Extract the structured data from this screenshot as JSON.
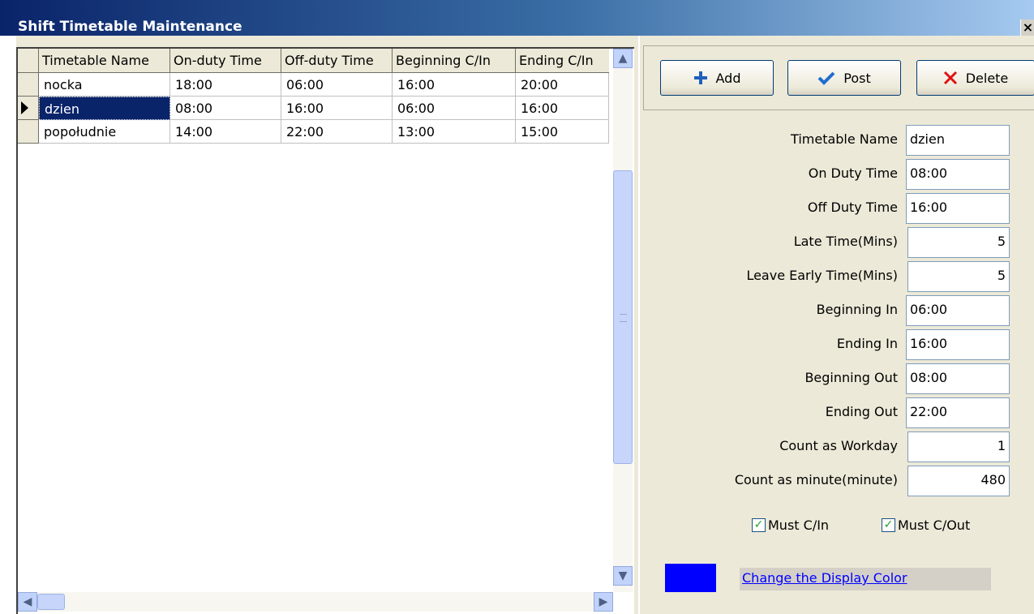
{
  "window": {
    "title": "Shift Timetable Maintenance",
    "close_glyph": "×"
  },
  "grid": {
    "columns": [
      "Timetable Name",
      "On-duty Time",
      "Off-duty Time",
      "Beginning C/In",
      "Ending C/In"
    ],
    "rows": [
      {
        "name": "nocka",
        "on": "18:00",
        "off": "06:00",
        "begin": "16:00",
        "end": "20:00",
        "selected": false
      },
      {
        "name": "dzien",
        "on": "08:00",
        "off": "16:00",
        "begin": "06:00",
        "end": "16:00",
        "selected": true
      },
      {
        "name": "popołudnie",
        "on": "14:00",
        "off": "22:00",
        "begin": "13:00",
        "end": "15:00",
        "selected": false
      }
    ]
  },
  "toolbar": {
    "add_label": "Add",
    "post_label": "Post",
    "delete_label": "Delete"
  },
  "form": {
    "timetable_name": {
      "label": "Timetable Name",
      "value": "dzien"
    },
    "on_duty": {
      "label": "On Duty Time",
      "value": "08:00"
    },
    "off_duty": {
      "label": "Off Duty Time",
      "value": "16:00"
    },
    "late_time": {
      "label": "Late Time(Mins)",
      "value": "5"
    },
    "leave_early": {
      "label": "Leave Early Time(Mins)",
      "value": "5"
    },
    "beginning_in": {
      "label": "Beginning In",
      "value": "06:00"
    },
    "ending_in": {
      "label": "Ending In",
      "value": "16:00"
    },
    "beginning_out": {
      "label": "Beginning Out",
      "value": "08:00"
    },
    "ending_out": {
      "label": "Ending Out",
      "value": "22:00"
    },
    "workday": {
      "label": "Count as Workday",
      "value": "1"
    },
    "minutes": {
      "label": "Count as minute(minute)",
      "value": "480"
    },
    "must_cin": {
      "label": "Must C/In",
      "checked": true
    },
    "must_cout": {
      "label": "Must C/Out",
      "checked": true
    },
    "color_link": "Change the Display Color",
    "display_color": "#0000ff"
  },
  "icons": {
    "add": "plus-icon",
    "post": "check-icon",
    "delete": "x-icon"
  }
}
